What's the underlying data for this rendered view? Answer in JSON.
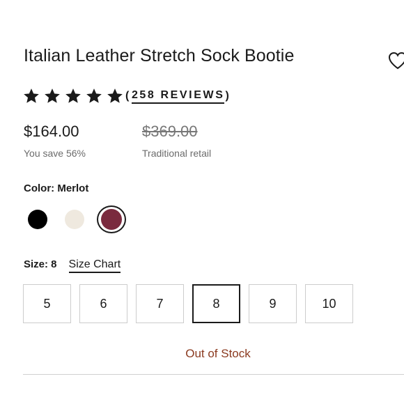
{
  "product": {
    "title": "Italian Leather Stretch Sock Bootie",
    "rating_stars": 5,
    "reviews_open": "(",
    "reviews_text": "258 REVIEWS",
    "reviews_close": ")"
  },
  "pricing": {
    "price": "$164.00",
    "savings": "You save 56%",
    "retail_price": "$369.00",
    "retail_label": "Traditional retail"
  },
  "color": {
    "label": "Color: Merlot",
    "swatches": [
      {
        "name": "black",
        "hex": "#000000",
        "selected": false
      },
      {
        "name": "cream",
        "hex": "#efe9df",
        "selected": false
      },
      {
        "name": "merlot",
        "hex": "#7a2a3e",
        "selected": true
      }
    ]
  },
  "size": {
    "label": "Size: 8",
    "chart_link": "Size Chart",
    "options": [
      "5",
      "6",
      "7",
      "8",
      "9",
      "10"
    ],
    "selected": "8"
  },
  "stock": {
    "status": "Out of Stock",
    "color": "#8b3a20"
  },
  "icons": {
    "wishlist": "heart-icon",
    "star": "star-icon"
  }
}
